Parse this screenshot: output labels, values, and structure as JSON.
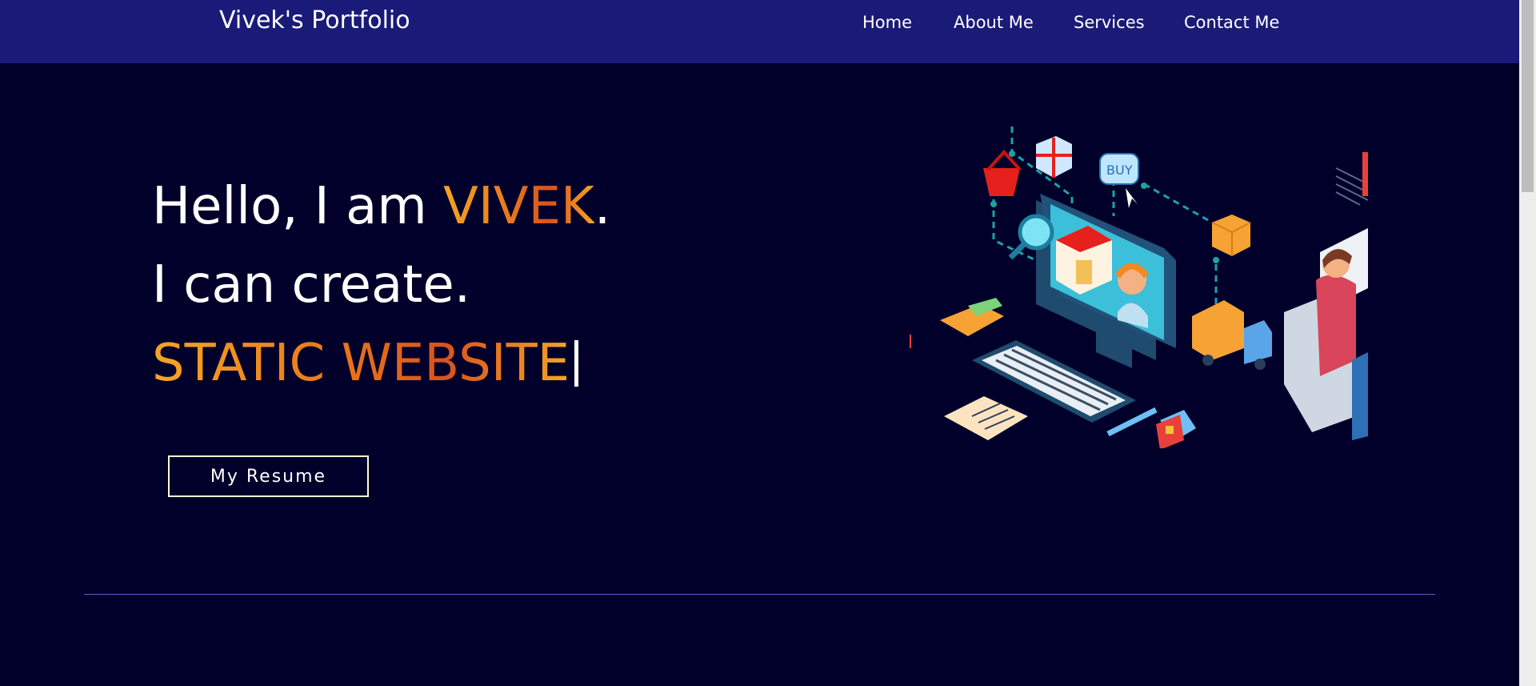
{
  "navbar": {
    "brand": "Vivek's Portfolio",
    "links": [
      {
        "label": "Home"
      },
      {
        "label": "About Me"
      },
      {
        "label": "Services"
      },
      {
        "label": "Contact Me"
      }
    ]
  },
  "hero": {
    "greeting_prefix": "Hello, I am ",
    "name": "VIVEK",
    "greeting_suffix": ".",
    "line2": "I can create.",
    "typed_text": "STATIC WEBSITE",
    "resume_button": "My Resume"
  },
  "illustration": {
    "buy_tag": "BUY"
  },
  "colors": {
    "navbar_bg": "#1a1a78",
    "page_bg": "#00002a",
    "accent_gradient_start": "#f5a524",
    "accent_gradient_end": "#d9521c",
    "divider": "#5b61b8"
  }
}
